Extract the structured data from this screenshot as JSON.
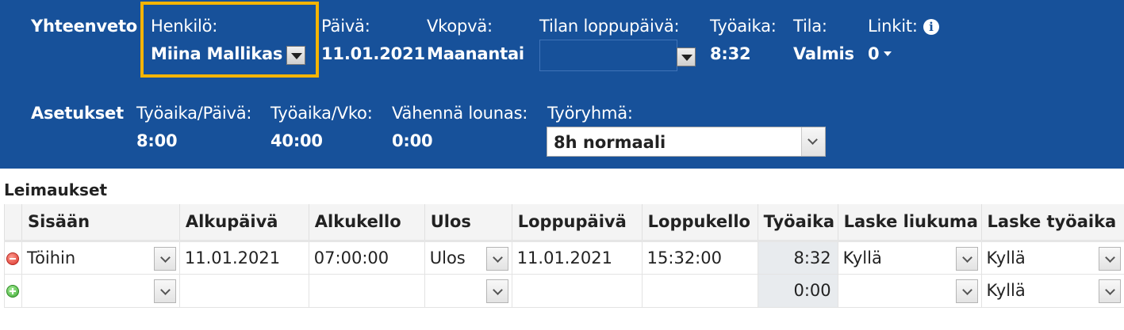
{
  "summary": {
    "section_label": "Yhteenveto",
    "person_label": "Henkilö:",
    "person_value": "Miina Mallikas",
    "date_label": "Päivä:",
    "date_value": "11.01.2021",
    "weekday_label": "Vkopvä:",
    "weekday_value": "Maanantai",
    "status_end_label": "Tilan loppupäivä:",
    "status_end_value": "",
    "worktime_label": "Työaika:",
    "worktime_value": "8:32",
    "state_label": "Tila:",
    "state_value": "Valmis",
    "links_label": "Linkit:",
    "links_value": "0"
  },
  "settings": {
    "section_label": "Asetukset",
    "day_worktime_label": "Työaika/Päivä:",
    "day_worktime_value": "8:00",
    "week_worktime_label": "Työaika/Vko:",
    "week_worktime_value": "40:00",
    "lunch_label": "Vähennä lounas:",
    "lunch_value": "0:00",
    "workgroup_label": "Työryhmä:",
    "workgroup_value": "8h normaali"
  },
  "stamps": {
    "title": "Leimaukset",
    "columns": [
      "Sisään",
      "Alkupäivä",
      "Alkukello",
      "Ulos",
      "Loppupäivä",
      "Loppukello",
      "Työaika",
      "Laske liukuma",
      "Laske työaika"
    ],
    "rows": [
      {
        "action": "remove",
        "in": "Töihin",
        "start_date": "11.01.2021",
        "start_time": "07:00:00",
        "out": "Ulos",
        "end_date": "11.01.2021",
        "end_time": "15:32:00",
        "worktime": "8:32",
        "calc_flex": "Kyllä",
        "calc_worktime": "Kyllä"
      },
      {
        "action": "add",
        "in": "",
        "start_date": "",
        "start_time": "",
        "out": "",
        "end_date": "",
        "end_time": "",
        "worktime": "0:00",
        "calc_flex": "",
        "calc_worktime": "Kyllä"
      }
    ]
  },
  "colors": {
    "header_bg": "#17519a",
    "highlight": "#f5b400"
  }
}
